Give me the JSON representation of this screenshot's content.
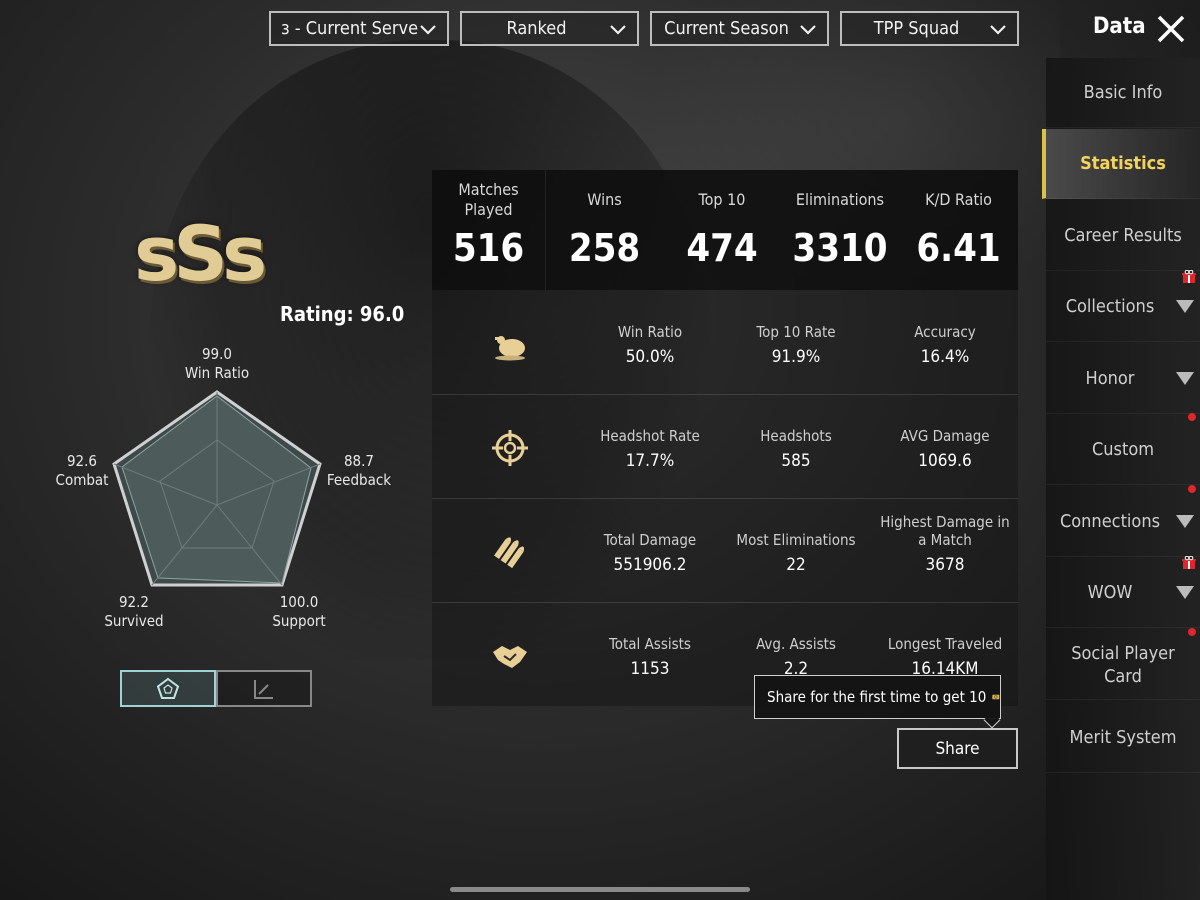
{
  "filters": {
    "server": "ɜ - Current Serve",
    "mode": "Ranked",
    "season": "Current Season",
    "squad": "TPP Squad"
  },
  "header": {
    "title": "Data"
  },
  "sidebar": {
    "items": [
      {
        "label": "Basic Info"
      },
      {
        "label": "Statistics"
      },
      {
        "label": "Career Results"
      },
      {
        "label": "Collections"
      },
      {
        "label": "Honor"
      },
      {
        "label": "Custom"
      },
      {
        "label": "Connections"
      },
      {
        "label": "WOW"
      },
      {
        "label": "Social Player Card"
      },
      {
        "label": "Merit System"
      }
    ]
  },
  "grade": "sSs",
  "rating": "Rating: 96.0",
  "radar": {
    "win_ratio": {
      "value": "99.0",
      "label": "Win Ratio"
    },
    "feedback": {
      "value": "88.7",
      "label": "Feedback"
    },
    "support": {
      "value": "100.0",
      "label": "Support"
    },
    "survived": {
      "value": "92.2",
      "label": "Survived"
    },
    "combat": {
      "value": "92.6",
      "label": "Combat"
    }
  },
  "summary": {
    "matches": {
      "label": "Matches Played",
      "value": "516"
    },
    "wins": {
      "label": "Wins",
      "value": "258"
    },
    "top10": {
      "label": "Top 10",
      "value": "474"
    },
    "elims": {
      "label": "Eliminations",
      "value": "3310"
    },
    "kd": {
      "label": "K/D Ratio",
      "value": "6.41"
    }
  },
  "rows": [
    {
      "icon": "chicken-icon",
      "cells": [
        {
          "label": "Win Ratio",
          "value": "50.0%"
        },
        {
          "label": "Top 10 Rate",
          "value": "91.9%"
        },
        {
          "label": "Accuracy",
          "value": "16.4%"
        }
      ]
    },
    {
      "icon": "crosshair-icon",
      "cells": [
        {
          "label": "Headshot Rate",
          "value": "17.7%"
        },
        {
          "label": "Headshots",
          "value": "585"
        },
        {
          "label": "AVG Damage",
          "value": "1069.6"
        }
      ]
    },
    {
      "icon": "bullets-icon",
      "cells": [
        {
          "label": "Total Damage",
          "value": "551906.2"
        },
        {
          "label": "Most Eliminations",
          "value": "22"
        },
        {
          "label": "Highest Damage in a Match",
          "value": "3678"
        }
      ]
    },
    {
      "icon": "handshake-icon",
      "cells": [
        {
          "label": "Total Assists",
          "value": "1153"
        },
        {
          "label": "Avg. Assists",
          "value": "2.2"
        },
        {
          "label": "Longest Traveled",
          "value": "16.14KM"
        }
      ]
    }
  ],
  "tooltip": "Share for the first time to get 10",
  "share_label": "Share",
  "colors": {
    "accent": "#f3d35a",
    "grade_gold": "#e2cc95",
    "notification": "#e0262c"
  }
}
